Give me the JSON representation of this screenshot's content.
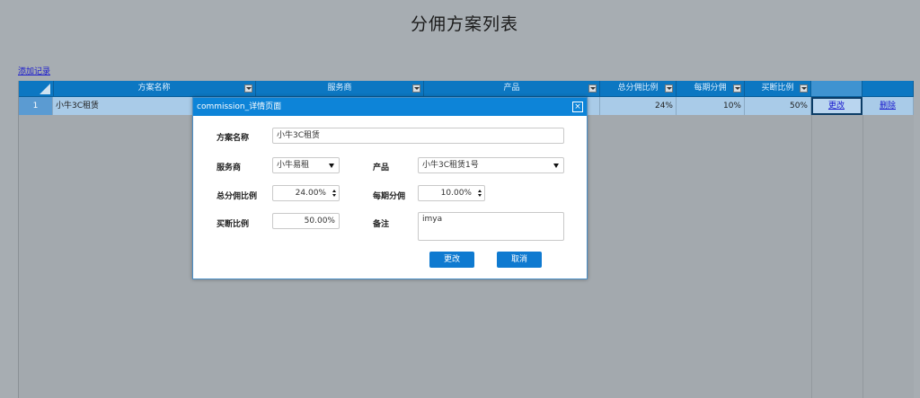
{
  "page": {
    "title": "分佣方案列表",
    "add_link": "添加记录"
  },
  "grid": {
    "columns": [
      {
        "label": "方案名称"
      },
      {
        "label": "服务商"
      },
      {
        "label": "产品"
      },
      {
        "label": "总分佣比例"
      },
      {
        "label": "每期分佣"
      },
      {
        "label": "买断比例"
      }
    ],
    "rows": [
      {
        "num": "1",
        "name": "小牛3C租赁",
        "total_ratio": "24%",
        "period": "10%",
        "buyout": "50%",
        "edit": "更改",
        "delete": "删除"
      }
    ]
  },
  "modal": {
    "title": "commission_详情页面",
    "close": "×",
    "fields": {
      "scheme_name": {
        "label": "方案名称",
        "value": "小牛3C租赁"
      },
      "provider": {
        "label": "服务商",
        "value": "小牛易租"
      },
      "product": {
        "label": "产品",
        "value": "小牛3C租赁1号"
      },
      "total_ratio": {
        "label": "总分佣比例",
        "value": "24.00%"
      },
      "period": {
        "label": "每期分佣",
        "value": "10.00%"
      },
      "buyout": {
        "label": "买断比例",
        "value": "50.00%"
      },
      "remark": {
        "label": "备注",
        "value": "imya"
      }
    },
    "buttons": {
      "save": "更改",
      "cancel": "取消"
    }
  },
  "colors": {
    "header": "#0c77c2",
    "accent": "#0f7ad0",
    "row": "#a9cbe8"
  }
}
